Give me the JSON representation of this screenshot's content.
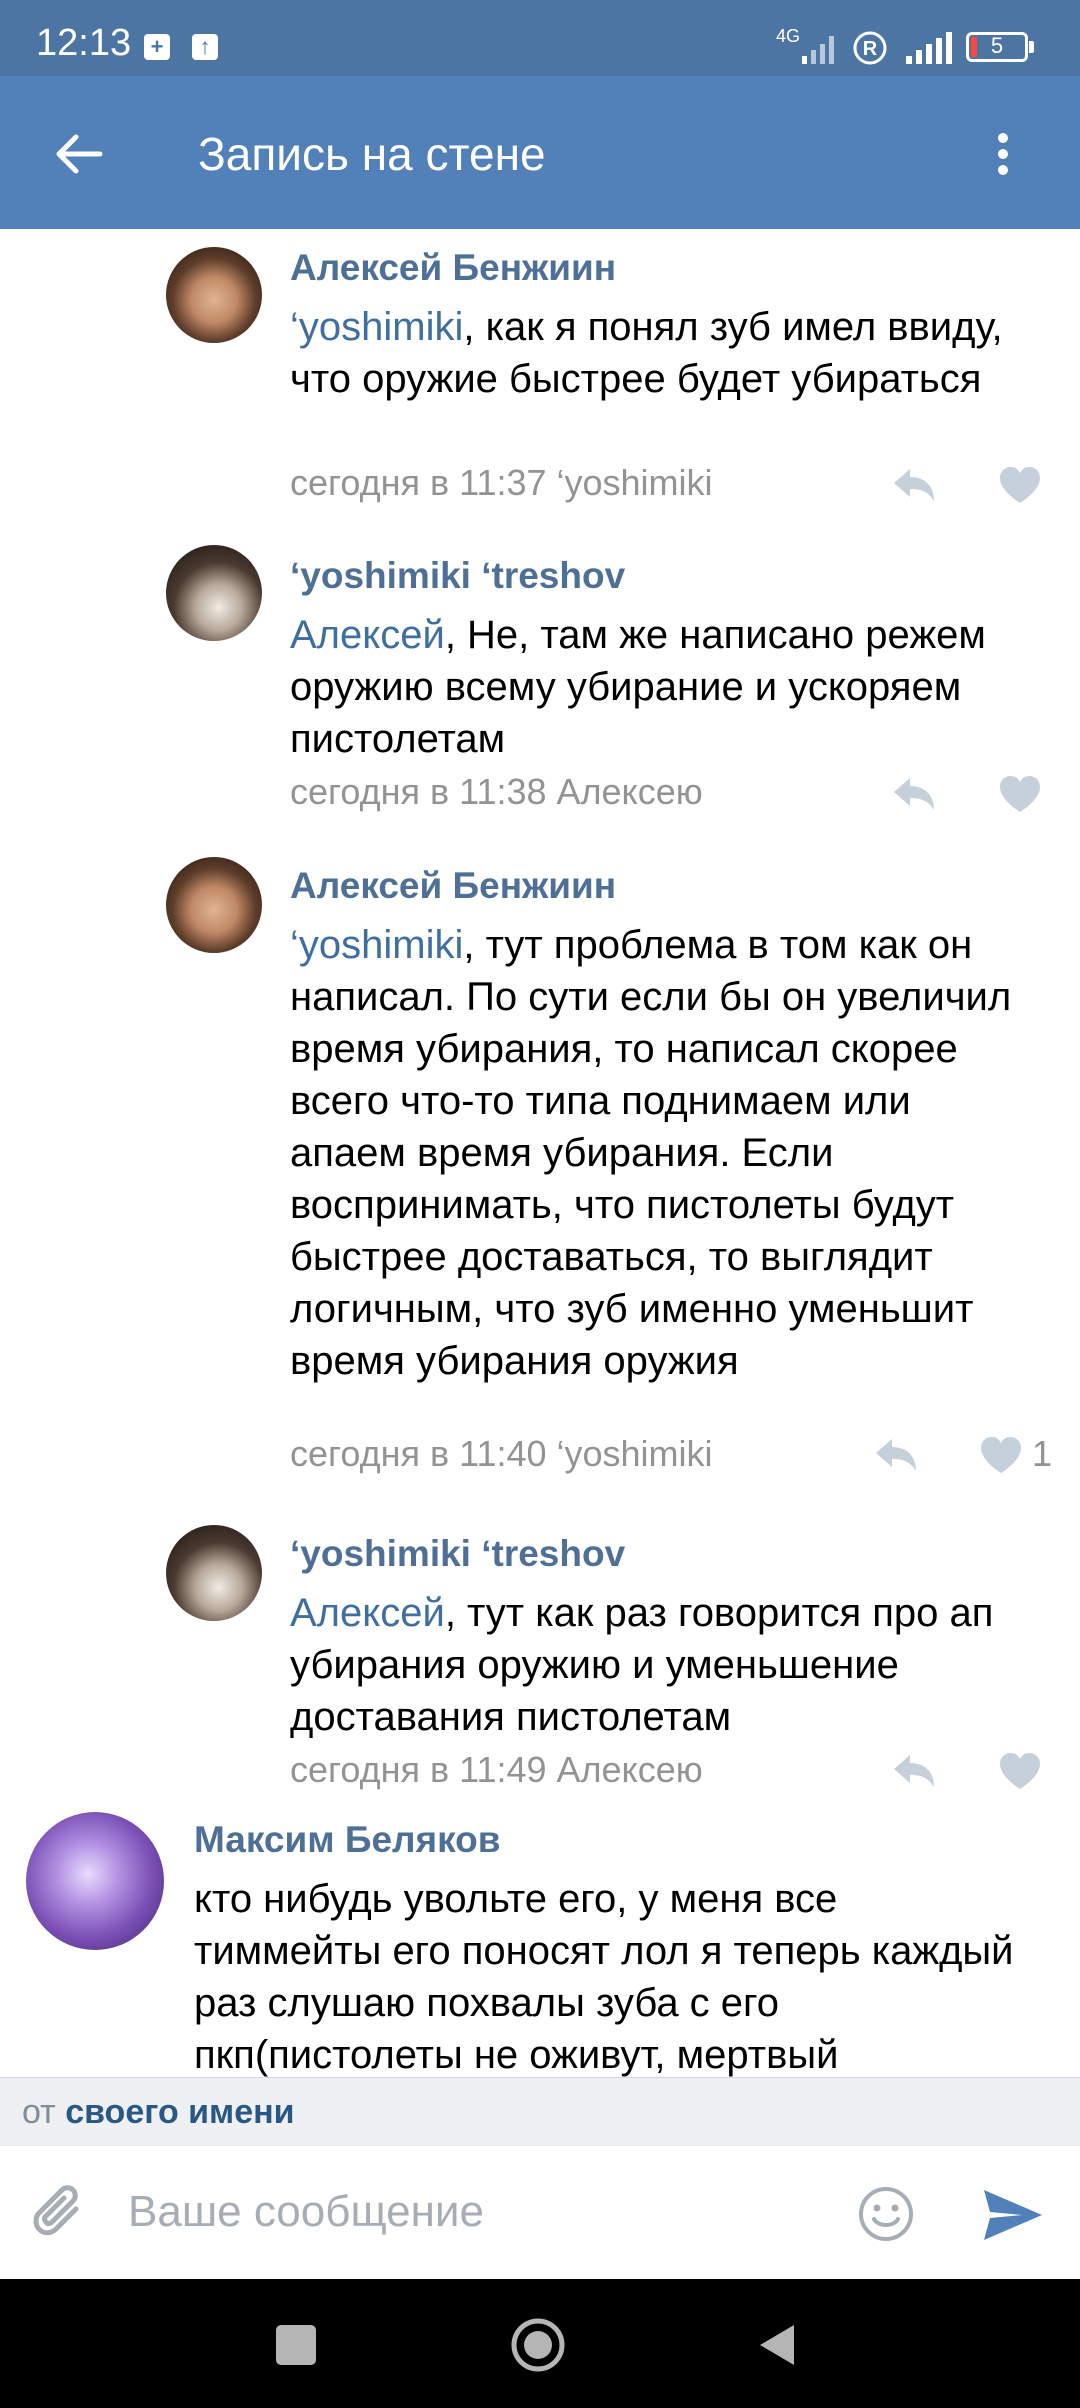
{
  "status_bar": {
    "time": "12:13",
    "network": "4G",
    "battery": "5"
  },
  "app_bar": {
    "title": "Запись на стене"
  },
  "comments": [
    {
      "author": "Алексей Бенжиин",
      "mention": "‘yoshimiki",
      "body": ", как я понял зуб имел ввиду, что оружие быстрее будет убираться",
      "meta": "сегодня в 11:37 ‘yoshimiki",
      "likes": ""
    },
    {
      "author": "‘yoshimiki ‘treshov",
      "mention": "Алексей",
      "body": ", Не, там же написано режем оружию всему убирание и ускоряем пистолетам",
      "meta": "сегодня в 11:38 Алексею",
      "likes": ""
    },
    {
      "author": "Алексей Бенжиин",
      "mention": "‘yoshimiki",
      "body": ", тут проблема в том как он написал. По сути если бы он увеличил время убирания, то написал скорее всего что-то типа поднимаем или апаем время убирания. Если воспринимать, что пистолеты будут быстрее доставаться, то выглядит логичным, что зуб именно уменьшит время убирания оружия",
      "meta": "сегодня в 11:40 ‘yoshimiki",
      "likes": "1"
    },
    {
      "author": "‘yoshimiki ‘treshov",
      "mention": "Алексей",
      "body": ", тут как раз говорится про ап убирания оружию и уменьшение доставания пистолетам",
      "meta": "сегодня в 11:49 Алексею",
      "likes": ""
    },
    {
      "author": "Максим Беляков",
      "mention": "",
      "body": "кто нибудь увольте его, у меня все тиммейты его поносят лол я теперь каждый раз слушаю похвалы зуба с его пкп(пистолеты не оживут, мертвый",
      "meta": "",
      "likes": ""
    }
  ],
  "from_bar": {
    "prefix": "от",
    "name": "своего имени"
  },
  "composer": {
    "placeholder": "Ваше сообщение"
  },
  "colors": {
    "header": "#5181b8",
    "status_bar": "#4d75a3",
    "link": "#4e6f96",
    "meta": "#939393",
    "icon_grey": "#c5d0db",
    "send": "#5181b8"
  }
}
